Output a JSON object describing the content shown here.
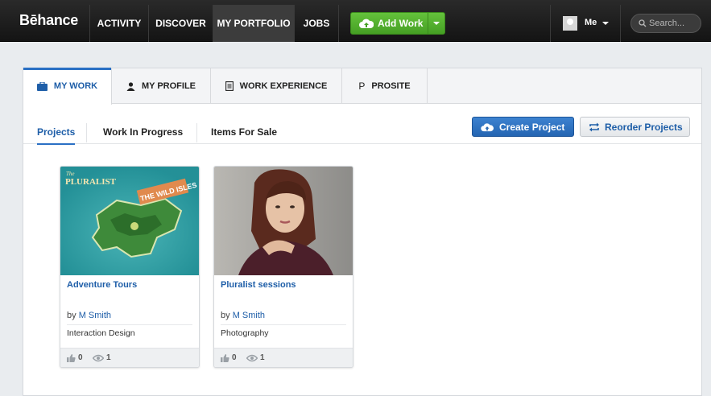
{
  "brand": {
    "logo": "Bēhance"
  },
  "nav": {
    "items": [
      {
        "label": "ACTIVITY"
      },
      {
        "label": "DISCOVER"
      },
      {
        "label": "MY PORTFOLIO"
      },
      {
        "label": "JOBS"
      }
    ],
    "add_work_label": "Add Work",
    "user_label": "Me",
    "search_placeholder": "Search..."
  },
  "tabs": [
    {
      "label": "MY WORK",
      "icon": "briefcase-icon"
    },
    {
      "label": "MY PROFILE",
      "icon": "person-icon"
    },
    {
      "label": "WORK EXPERIENCE",
      "icon": "document-icon"
    },
    {
      "label": "PROSITE",
      "icon": "prosite-p-icon",
      "glyph": "P"
    }
  ],
  "subtabs": [
    {
      "label": "Projects"
    },
    {
      "label": "Work In Progress"
    },
    {
      "label": "Items For Sale"
    }
  ],
  "actions": {
    "create_project": "Create Project",
    "reorder_projects": "Reorder Projects"
  },
  "projects": [
    {
      "title": "Adventure Tours",
      "by": "by",
      "owner": "M Smith",
      "field": "Interaction Design",
      "appreciations": "0",
      "views": "1",
      "thumb_text_1": "The",
      "thumb_text_2": "PLURALIST",
      "thumb_text_3": "THE WILD ISLES"
    },
    {
      "title": "Pluralist sessions",
      "by": "by",
      "owner": "M Smith",
      "field": "Photography",
      "appreciations": "0",
      "views": "1"
    }
  ],
  "colors": {
    "accent_blue": "#1e5ea8",
    "add_work_green": "#45a024",
    "topbar": "#1a1a1a"
  }
}
